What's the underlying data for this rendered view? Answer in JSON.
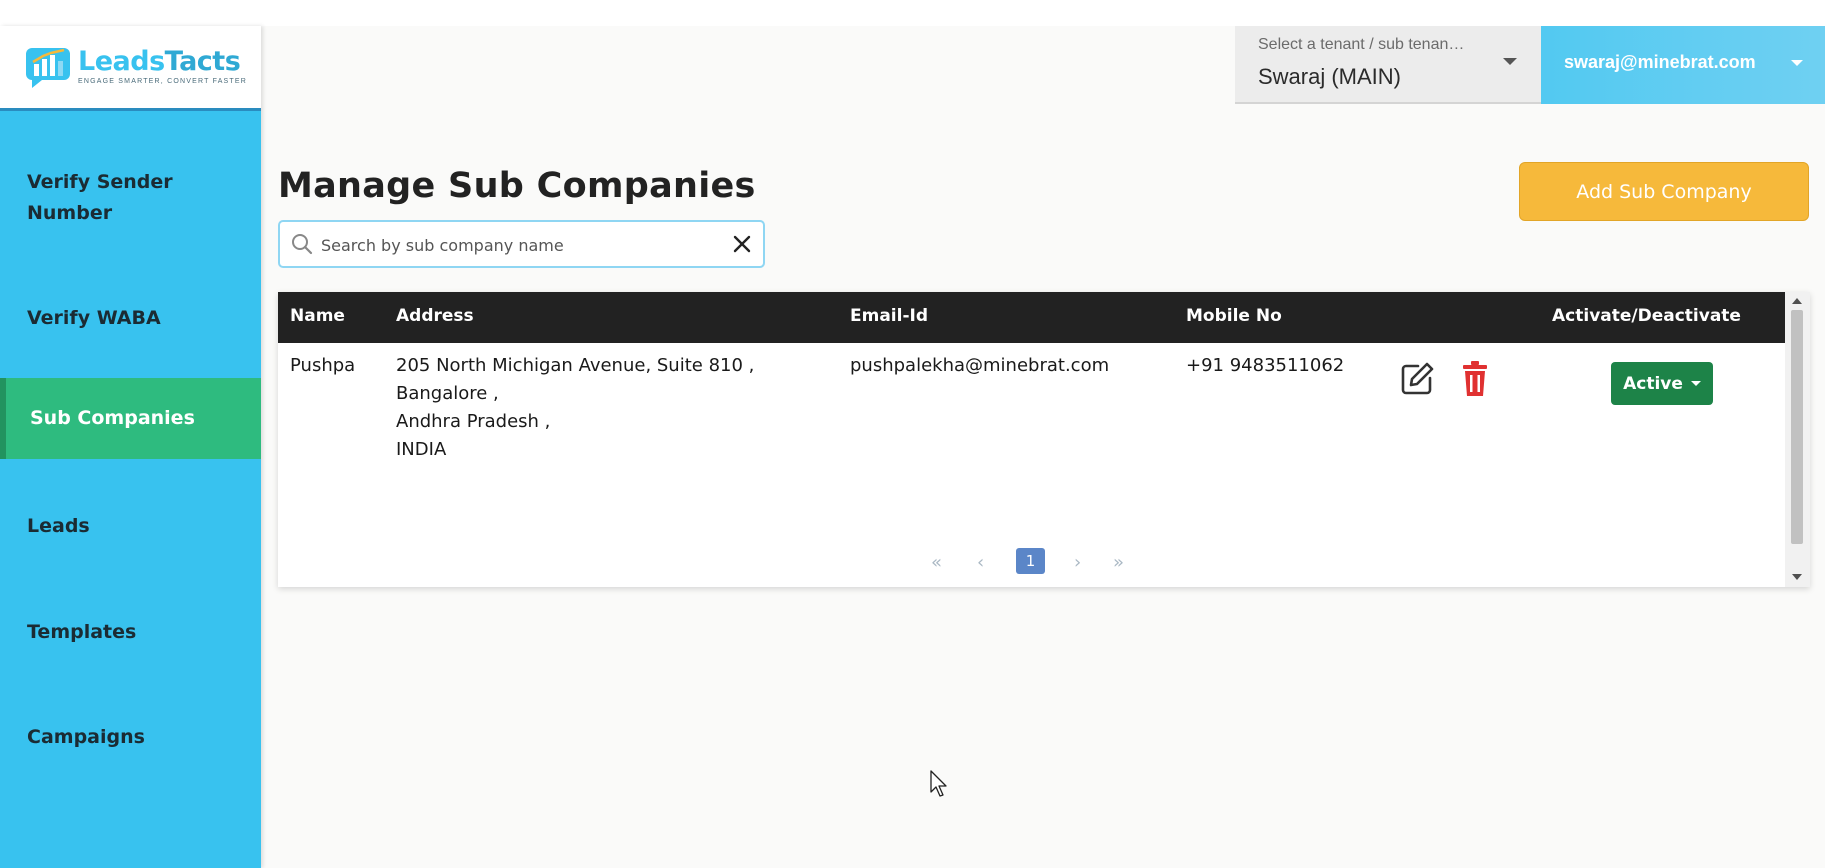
{
  "brand": {
    "name_part1": "Leads",
    "name_part2": "Tacts",
    "tagline": "ENGAGE SMARTER, CONVERT FASTER"
  },
  "sidebar": {
    "items": [
      {
        "label": "Verify Sender Number",
        "active": false
      },
      {
        "label": "Verify WABA",
        "active": false
      },
      {
        "label": "Sub Companies",
        "active": true
      },
      {
        "label": "Leads",
        "active": false
      },
      {
        "label": "Templates",
        "active": false
      },
      {
        "label": "Campaigns",
        "active": false
      }
    ]
  },
  "header": {
    "tenant_label": "Select a tenant / sub tenan…",
    "tenant_value": "Swaraj (MAIN)",
    "user_email": "swaraj@minebrat.com"
  },
  "page": {
    "title": "Manage Sub Companies",
    "add_button_label": "Add Sub Company"
  },
  "search": {
    "placeholder": "Search by sub company name",
    "value": ""
  },
  "table": {
    "columns": [
      "Name",
      "Address",
      "Email-Id",
      "Mobile No",
      "Activate/Deactivate"
    ],
    "rows": [
      {
        "name": "Pushpa",
        "address_lines": [
          "205 North Michigan Avenue, Suite 810 ,",
          "Bangalore ,",
          "Andhra Pradesh ,",
          "INDIA"
        ],
        "email": "pushpalekha@minebrat.com",
        "mobile": "+91 9483511062",
        "status": "Active"
      }
    ]
  },
  "pagination": {
    "first": "«",
    "prev": "‹",
    "current": "1",
    "next": "›",
    "last": "»"
  },
  "colors": {
    "sidebar_bg": "#38c2ef",
    "active_nav": "#2ebb7f",
    "add_button": "#f6b93b",
    "status_active": "#1d8348",
    "delete_icon": "#e03131",
    "table_header": "#222222"
  }
}
